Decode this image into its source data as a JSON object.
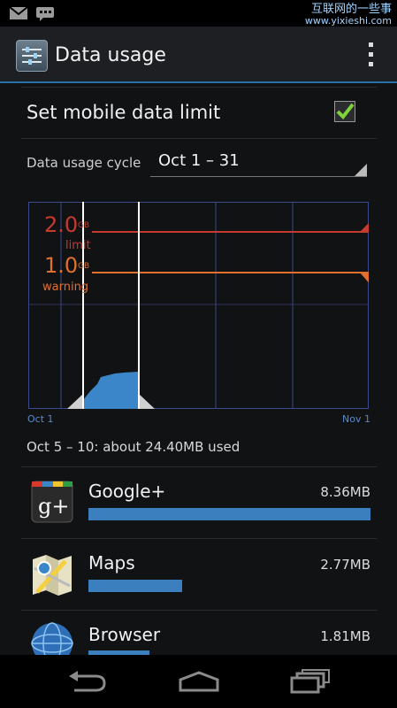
{
  "status_bar": {
    "watermark_line1": "互联网的一些事",
    "watermark_line2": "www.yixieshi.com"
  },
  "action_bar": {
    "title": "Data usage"
  },
  "settings": {
    "mobile_limit_label": "Set mobile data limit",
    "mobile_limit_checked": true,
    "cycle_label": "Data usage cycle",
    "cycle_value": "Oct 1 – 31"
  },
  "chart": {
    "limit_value": "2.0",
    "limit_unit": "GB",
    "limit_label": "limit",
    "warning_value": "1.0",
    "warning_unit": "GB",
    "warning_label": "warning",
    "x_start_label": "Oct 1",
    "x_end_label": "Nov 1",
    "colors": {
      "grid": "#3a4a8a",
      "limit": "#c73a2e",
      "warning": "#e0702e",
      "usage": "#3a86c8"
    }
  },
  "summary": {
    "used_text": "Oct 5 – 10: about 24.40MB used"
  },
  "apps": [
    {
      "name": "Google+",
      "size": "8.36MB",
      "usage_fraction": 1.0,
      "icon": "google-plus-icon"
    },
    {
      "name": "Maps",
      "size": "2.77MB",
      "usage_fraction": 0.331,
      "icon": "maps-icon"
    },
    {
      "name": "Browser",
      "size": "1.81MB",
      "usage_fraction": 0.216,
      "icon": "browser-icon"
    }
  ]
}
